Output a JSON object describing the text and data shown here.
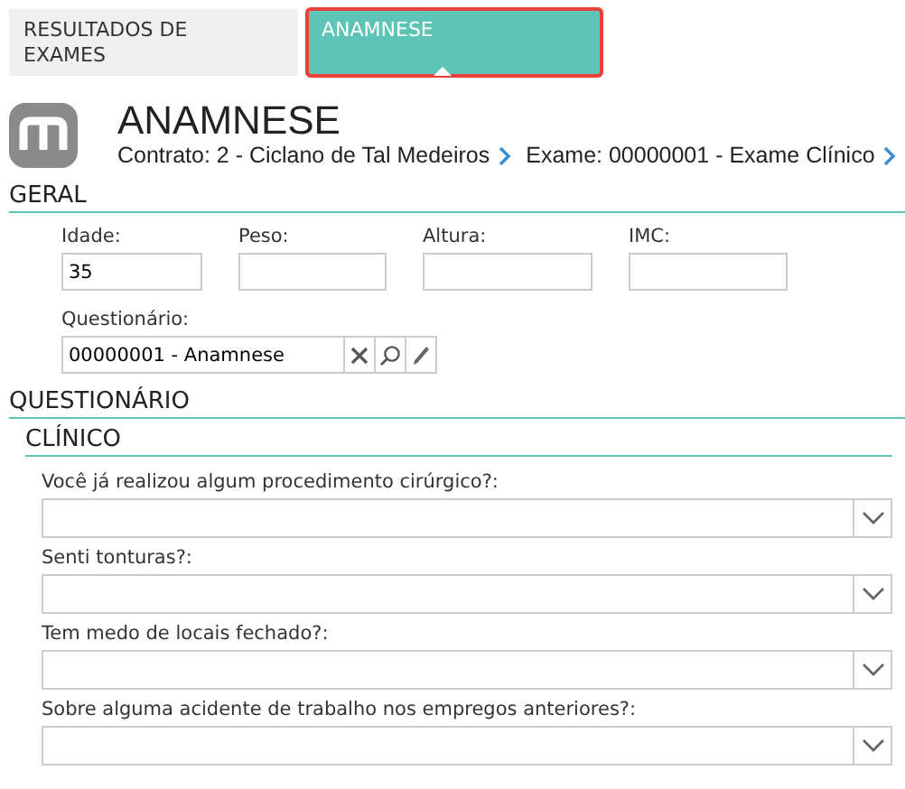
{
  "tabs": [
    {
      "label": "RESULTADOS DE EXAMES",
      "selected": false,
      "highlighted": false
    },
    {
      "label": "ANAMNESE",
      "selected": true,
      "highlighted": true
    }
  ],
  "header": {
    "title": "ANAMNESE",
    "breadcrumbs": [
      "Contrato: 2 - Ciclano de Tal Medeiros",
      "Exame: 00000001 - Exame Clínico"
    ]
  },
  "geral": {
    "heading": "GERAL",
    "fields": [
      {
        "label": "Idade:",
        "value": "35"
      },
      {
        "label": "Peso:"
      },
      {
        "label": "Altura:"
      },
      {
        "label": "IMC:"
      }
    ],
    "questionnaire": {
      "label": "Questionário:",
      "value": "00000001 - Anamnese"
    }
  },
  "questionario": {
    "heading": "QUESTIONÁRIO",
    "subheading": "CLÍNICO",
    "questions": [
      {
        "label": "Você já realizou algum procedimento cirúrgico?:"
      },
      {
        "label": "Senti tonturas?:"
      },
      {
        "label": "Tem medo de locais fechado?:"
      },
      {
        "label": "Sobre alguma acidente de trabalho nos empregos anteriores?:"
      }
    ]
  }
}
